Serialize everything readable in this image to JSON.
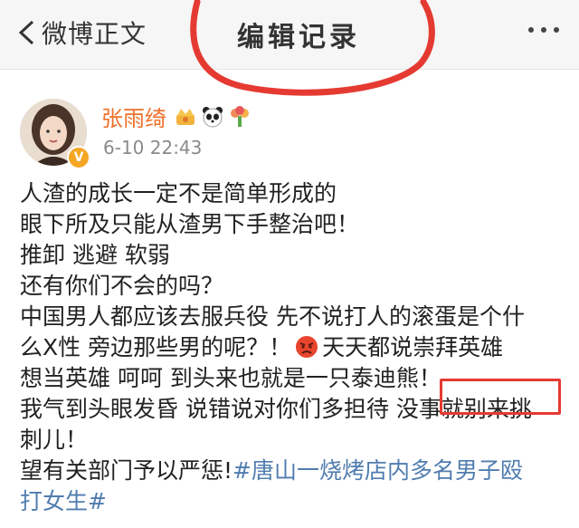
{
  "nav": {
    "back_label": "微博正文",
    "title": "编辑记录"
  },
  "post": {
    "username": "张雨绮",
    "time": "6-10 22:43",
    "lines": [
      "人渣的成长一定不是简单形成的",
      "眼下所及只能从渣男下手整治吧！",
      "推卸 逃避 软弱",
      "还有你们不会的吗？",
      "中国男人都应该去服兵役 先不说打人的滚蛋是个什",
      "么X性 旁边那些男的呢？！",
      "天天都说崇拜英雄",
      "想当英雄 呵呵 到头来也就是一只泰迪熊！",
      "我气到头眼发昏 说错说对你们多担待 没事就别来挑",
      "刺儿！",
      "望有关部门予以严惩!",
      "#唐山一烧烤店内多名男子殴",
      "打女生#"
    ]
  },
  "colors": {
    "username": "#f0702a",
    "link": "#507daf",
    "highlight": "#e53a32"
  },
  "icons": [
    "back-chevron-icon",
    "more-dots-icon",
    "verified-v-icon",
    "crown-badge-icon",
    "panda-badge-icon",
    "flower-badge-icon",
    "angry-face-emoji-icon"
  ]
}
